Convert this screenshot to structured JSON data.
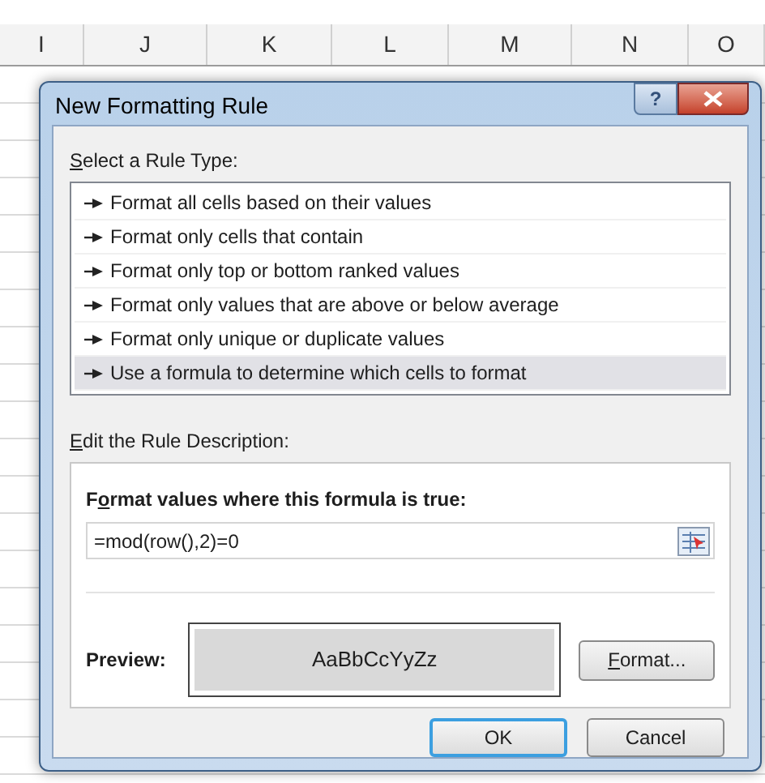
{
  "sheet": {
    "columns": [
      "I",
      "J",
      "K",
      "L",
      "M",
      "N",
      "O"
    ]
  },
  "dialog": {
    "title": "New Formatting Rule",
    "help_button": "?",
    "rule_type_label": {
      "key": "S",
      "post": "elect a Rule Type:"
    },
    "rule_types": [
      {
        "label": "Format all cells based on their values",
        "selected": false
      },
      {
        "label": "Format only cells that contain",
        "selected": false
      },
      {
        "label": "Format only top or bottom ranked values",
        "selected": false
      },
      {
        "label": "Format only values that are above or below average",
        "selected": false
      },
      {
        "label": "Format only unique or duplicate values",
        "selected": false
      },
      {
        "label": "Use a formula to determine which cells to format",
        "selected": true
      }
    ],
    "description_label": {
      "key": "E",
      "post": "dit the Rule Description:"
    },
    "formula_label": {
      "pre": "F",
      "key": "o",
      "post": "rmat values where this formula is true:"
    },
    "formula": "=mod(row(),2)=0",
    "preview_label": "Preview:",
    "preview_sample": "AaBbCcYyZz",
    "format_button": {
      "key": "F",
      "post": "ormat..."
    },
    "buttons": [
      {
        "label": "OK",
        "default": true
      },
      {
        "label": "Cancel",
        "default": false
      }
    ]
  }
}
